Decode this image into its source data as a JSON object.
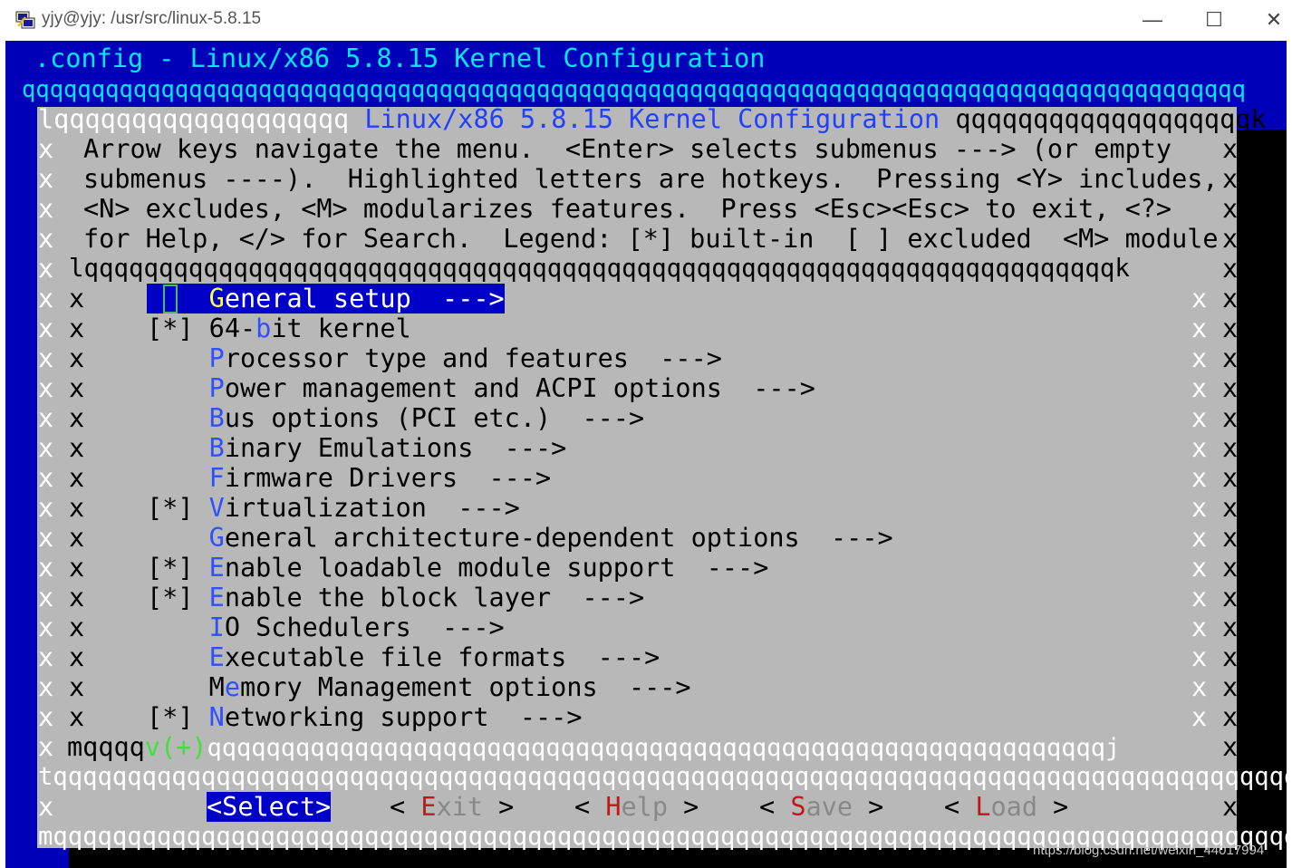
{
  "window": {
    "title": "yjy@yjy: /usr/src/linux-5.8.15",
    "minimize_glyph": "—",
    "maximize_glyph": "☐",
    "close_glyph": "✕"
  },
  "terminal": {
    "header": ".config - Linux/x86 5.8.15 Kernel Configuration",
    "header_rule": "qqqqqqqqqqqqqqqqqqqqqqqqqqqqqqqqqqqqqqqqqqqqqqqqqqqqqqqqqqqqqqqqqqqqqqqqqqqqqqqqqqqqqqqq",
    "box_top_left": "lqqqqqqqqqqqqqqqqqqq",
    "box_title": "Linux/x86 5.8.15 Kernel Configuration",
    "box_top_right": "qqqqqqqqqqqqqqqqqqqk",
    "help_lines": [
      "Arrow keys navigate the menu.  <Enter> selects submenus ---> (or empty",
      "submenus ----).  Highlighted letters are hotkeys.  Pressing <Y> includes,",
      "<N> excludes, <M> modularizes features.  Press <Esc><Esc> to exit, <?>",
      "for Help, </> for Search.  Legend: [*] built-in  [ ] excluded  <M> module"
    ],
    "menu_top": "lqqqqqqqqqqqqqqqqqqqqqqqqqqqqqqqqqqqqqqqqqqqqqqqqqqqqqqqqqqqqqqqqqqqqqk",
    "menu_items": [
      {
        "mark": "   ",
        "hot": "G",
        "rest": "eneral setup  --->",
        "selected": true
      },
      {
        "mark": "[*]",
        "pre": "64-",
        "hot": "b",
        "rest": "it kernel",
        "selected": false
      },
      {
        "mark": "   ",
        "hot": "P",
        "rest": "rocessor type and features  --->",
        "selected": false
      },
      {
        "mark": "   ",
        "hot": "P",
        "rest": "ower management and ACPI options  --->",
        "selected": false
      },
      {
        "mark": "   ",
        "hot": "B",
        "rest": "us options (PCI etc.)  --->",
        "selected": false
      },
      {
        "mark": "   ",
        "hot": "B",
        "rest": "inary Emulations  --->",
        "selected": false
      },
      {
        "mark": "   ",
        "hot": "F",
        "rest": "irmware Drivers  --->",
        "selected": false
      },
      {
        "mark": "[*]",
        "hot": "V",
        "rest": "irtualization  --->",
        "selected": false
      },
      {
        "mark": "   ",
        "hot": "G",
        "rest": "eneral architecture-dependent options  --->",
        "selected": false
      },
      {
        "mark": "[*]",
        "hot": "E",
        "rest": "nable loadable module support  --->",
        "selected": false
      },
      {
        "mark": "[*]",
        "hot": "E",
        "rest": "nable the block layer  --->",
        "selected": false
      },
      {
        "mark": "   ",
        "hot": "I",
        "rest": "O Schedulers  --->",
        "selected": false
      },
      {
        "mark": "   ",
        "hot": "E",
        "rest": "xecutable file formats  --->",
        "selected": false
      },
      {
        "mark": "   ",
        "pre": "M",
        "hot": "e",
        "rest": "mory Management options  --->",
        "selected": false
      },
      {
        "mark": "[*]",
        "hot": "N",
        "rest": "etworking support  --->",
        "selected": false
      }
    ],
    "menu_bottom_left": "mqqqq",
    "more_indicator": "v(+)",
    "menu_bottom_right": "qqqqqqqqqqqqqqqqqqqqqqqqqqqqqqqqqqqqqqqqqqqqqqqqqqqqqqqqqqqqqj",
    "separator": "tqqqqqqqqqqqqqqqqqqqqqqqqqqqqqqqqqqqqqqqqqqqqqqqqqqqqqqqqqqqqqqqqqqqqqqqqqqqqqqqqqqqqqqqqu",
    "buttons": {
      "select": "<Select>",
      "exit_hot": "E",
      "exit_rest": "xit",
      "help_hot": "H",
      "help_rest": "elp",
      "save_hot": "S",
      "save_rest": "ave",
      "load_hot": "L",
      "load_rest": "oad"
    },
    "box_bottom": "mqqqqqqqqqqqqqqqqqqqqqqqqqqqqqqqqqqqqqqqqqqqqqqqqqqqqqqqqqqqqqqqqqqqqqqqqqqqqqqqqqqqqqqqj",
    "border_x": "x"
  },
  "watermark": "https://blog.csdn.net/weixin_44017994",
  "colors": {
    "terminal_bg": "#0000b8",
    "dialog_bg": "#b8b8b8",
    "header_text": "#00e8ff",
    "hotkey": "#3050ff",
    "button_hotkey": "#c01818",
    "selection_bg": "#0000c8",
    "selection_hotkey": "#ffff40"
  }
}
